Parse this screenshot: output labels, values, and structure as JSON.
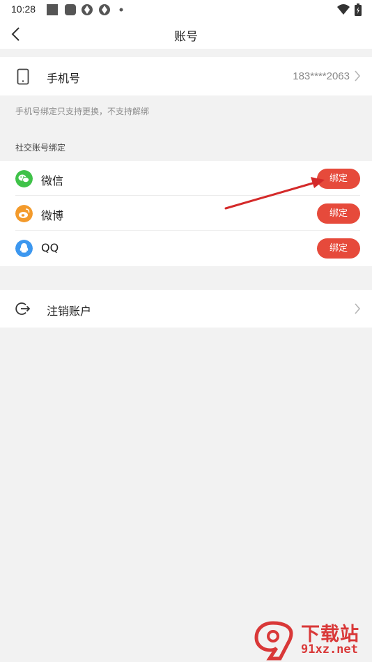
{
  "status_bar": {
    "time": "10:28",
    "icons": [
      "square-icon",
      "rounded-square-icon",
      "aperture-icon",
      "aperture-icon",
      "dot-icon",
      "wifi-icon",
      "battery-charging-icon"
    ]
  },
  "nav": {
    "back_icon": "chevron-left-icon",
    "title": "账号"
  },
  "phone": {
    "icon": "mobile-phone-icon",
    "label": "手机号",
    "value": "183****2063"
  },
  "phone_hint": "手机号绑定只支持更换，不支持解绑",
  "social_section_label": "社交账号绑定",
  "social_accounts": [
    {
      "name": "微信",
      "icon": "wechat-icon",
      "icon_color": "#3fc249",
      "button": "绑定"
    },
    {
      "name": "微博",
      "icon": "weibo-icon",
      "icon_color": "#f39a2b",
      "button": "绑定"
    },
    {
      "name": "QQ",
      "icon": "qq-icon",
      "icon_color": "#3c97ef",
      "button": "绑定"
    }
  ],
  "logout": {
    "icon": "logout-icon",
    "label": "注销账户"
  },
  "colors": {
    "accent": "#e64a3b",
    "background": "#f2f2f2",
    "annotation_arrow": "#d42a2a"
  },
  "watermark": {
    "logo_text": "9",
    "title": "下载站",
    "url": "91xz.net"
  }
}
